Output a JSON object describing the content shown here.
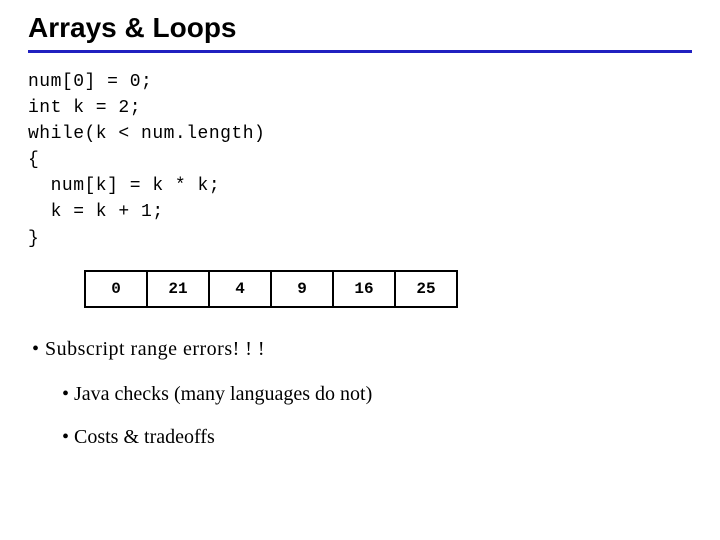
{
  "title": "Arrays & Loops",
  "code": "num[0] = 0;\nint k = 2;\nwhile(k < num.length)\n{\n  num[k] = k * k;\n  k = k + 1;\n}",
  "array": [
    "0",
    "21",
    "4",
    "9",
    "16",
    "25"
  ],
  "bullets": {
    "b1": "• Subscript range errors! ! !",
    "b2a": "• Java checks (many languages do not)",
    "b2b": "• Costs & tradeoffs"
  }
}
